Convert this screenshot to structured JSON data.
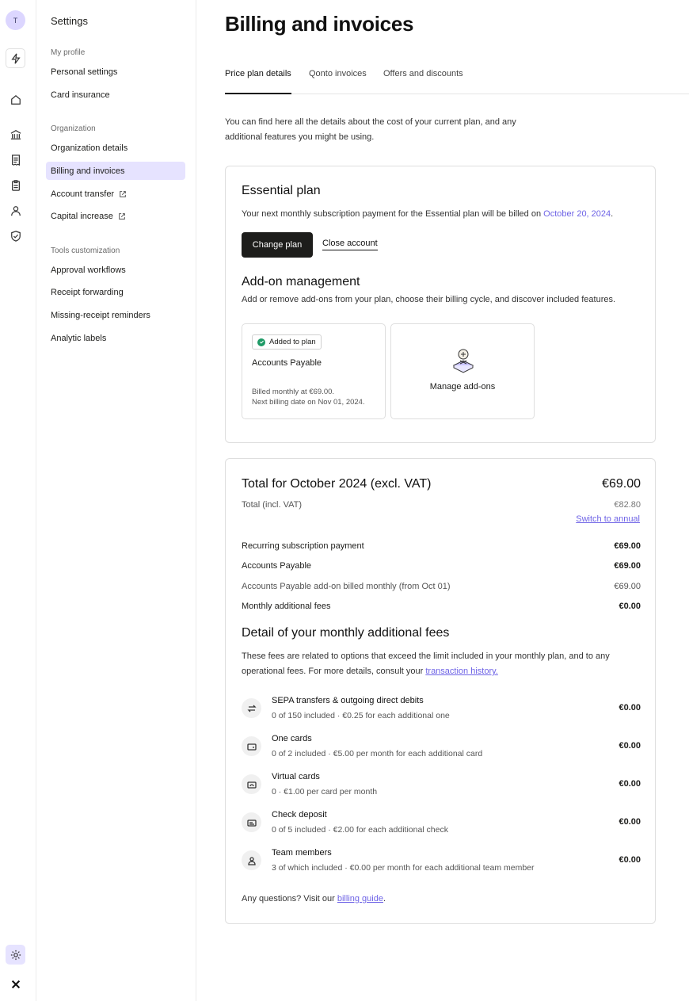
{
  "rail": {
    "avatar_initial": "T",
    "icons": [
      "bolt-icon",
      "home-icon",
      "bank-icon",
      "receipt-icon",
      "clipboard-icon",
      "team-icon",
      "shield-icon",
      "settings-icon",
      "qonto-logo"
    ]
  },
  "sidebar": {
    "title": "Settings",
    "groups": [
      {
        "label": "My profile",
        "items": [
          "Personal settings",
          "Card insurance"
        ]
      },
      {
        "label": "Organization",
        "items": [
          "Organization details",
          "Billing and invoices",
          "Account transfer",
          "Capital increase"
        ]
      },
      {
        "label": "Tools customization",
        "items": [
          "Approval workflows",
          "Receipt forwarding",
          "Missing-receipt reminders",
          "Analytic labels"
        ]
      }
    ]
  },
  "page": {
    "title": "Billing and invoices",
    "tabs": [
      "Price plan details",
      "Qonto invoices",
      "Offers and discounts"
    ],
    "intro": "You can find here all the details about the cost of your current plan, and any additional features you might be using."
  },
  "plan": {
    "name": "Essential plan",
    "next_payment_text": "Your next monthly subscription payment for the Essential plan will be billed on ",
    "next_payment_date": "October 20, 2024",
    "period": ".",
    "change_plan": "Change plan",
    "close_account": "Close account",
    "addons_title": "Add-on management",
    "addons_desc": "Add or remove add-ons from your plan, choose their billing cycle, and discover included features.",
    "addon_badge": "Added to plan",
    "addon_name": "Accounts Payable",
    "addon_billed": "Billed monthly at €69.00.",
    "addon_next": "Next billing date on Nov 01, 2024.",
    "manage_addons": "Manage add-ons"
  },
  "total": {
    "title": "Total for October 2024 (excl. VAT)",
    "amount": "€69.00",
    "incl_label": "Total (incl. VAT)",
    "incl_amount": "€82.80",
    "switch_annual": "Switch to annual",
    "lines": [
      {
        "label": "Recurring subscription payment",
        "value": "€69.00"
      },
      {
        "label": "Accounts Payable",
        "value": "€69.00"
      },
      {
        "label": "Accounts Payable add-on billed monthly (from Oct 01)",
        "value": "€69.00"
      },
      {
        "label": "Monthly additional fees",
        "value": "€0.00"
      }
    ]
  },
  "fees": {
    "title": "Detail of your monthly additional fees",
    "desc": "These fees are related to options that exceed the limit included in your monthly plan, and to any operational fees. For more details, consult your ",
    "desc_link": "transaction history.",
    "items": [
      {
        "icon": "transfer-icon",
        "title": "SEPA transfers & outgoing direct debits",
        "sub": "0 of 150 included · €0.25 for each additional one",
        "amount": "€0.00"
      },
      {
        "icon": "card-icon",
        "title": "One cards",
        "sub": "0 of 2 included · €5.00 per month for each additional card",
        "amount": "€0.00"
      },
      {
        "icon": "virtual-card-icon",
        "title": "Virtual cards",
        "sub": "0 · €1.00 per card per month",
        "amount": "€0.00"
      },
      {
        "icon": "check-icon",
        "title": "Check deposit",
        "sub": "0 of 5 included · €2.00 for each additional check",
        "amount": "€0.00"
      },
      {
        "icon": "person-icon",
        "title": "Team members",
        "sub": "3 of which included · €0.00 per month for each additional team member",
        "amount": "€0.00"
      }
    ],
    "questions": "Any questions? Visit our ",
    "guide_link": "billing guide",
    "period": "."
  },
  "colors": {
    "accent": "#6e63e6",
    "active_bg": "#e6e3ff",
    "success": "#1e9a66"
  }
}
